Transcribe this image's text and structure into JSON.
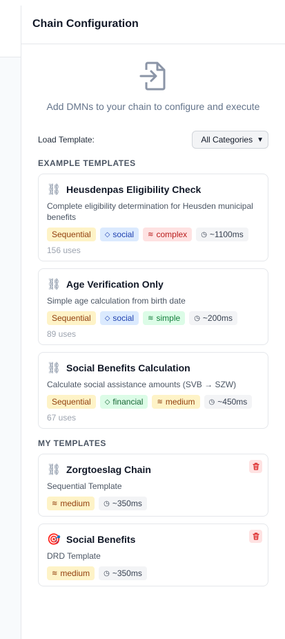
{
  "panel": {
    "title": "Chain Configuration"
  },
  "empty_state": {
    "text": "Add DMNs to your chain to configure and execute",
    "icon": "file-import-icon"
  },
  "load_template": {
    "label": "Load Template:",
    "selected_category": "All Categories"
  },
  "example_section": {
    "title": "EXAMPLE TEMPLATES",
    "templates": [
      {
        "icon": "chain-link-icon",
        "title": "Heusdenpas Eligibility Check",
        "description": "Complete eligibility determination for Heusden municipal benefits",
        "type": "Sequential",
        "category": "social",
        "complexity": "complex",
        "time": "~1100ms",
        "uses": "156 uses"
      },
      {
        "icon": "chain-link-icon",
        "title": "Age Verification Only",
        "description": "Simple age calculation from birth date",
        "type": "Sequential",
        "category": "social",
        "complexity": "simple",
        "time": "~200ms",
        "uses": "89 uses"
      },
      {
        "icon": "chain-link-icon",
        "title": "Social Benefits Calculation",
        "description": "Calculate social assistance amounts (SVB → SZW)",
        "type": "Sequential",
        "category": "financial",
        "complexity": "medium",
        "time": "~450ms",
        "uses": "67 uses"
      }
    ]
  },
  "my_section": {
    "title": "MY TEMPLATES",
    "templates": [
      {
        "icon": "chain-link-icon",
        "title": "Zorgtoeslag Chain",
        "description": "Sequential Template",
        "complexity": "medium",
        "time": "~350ms"
      },
      {
        "icon": "target-icon",
        "title": "Social Benefits",
        "description": "DRD Template",
        "complexity": "medium",
        "time": "~350ms"
      }
    ]
  },
  "icons": {
    "chain": "⛓",
    "target": "🎯",
    "category": "tag-icon",
    "complexity": "layers-icon",
    "time": "clock-icon",
    "delete": "trash-icon"
  }
}
